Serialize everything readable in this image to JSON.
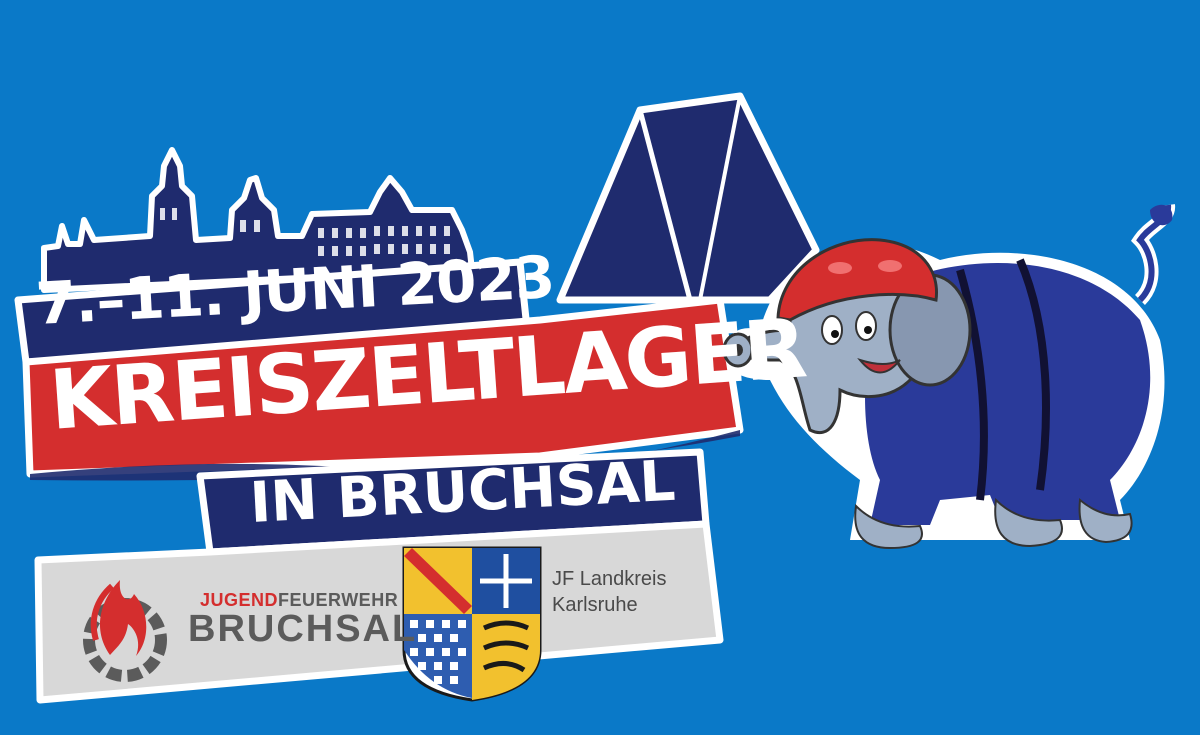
{
  "event": {
    "date": "7.–11. JUNI 2023",
    "title": "KREISZELTLAGER",
    "subtitle": "IN BRUCHSAL"
  },
  "organizers": {
    "jugendfeuerwehr_prefix": "JUGEND",
    "jugendfeuerwehr_suffix": "FEUERWEHR",
    "jugendfeuerwehr_city": "BRUCHSAL",
    "jf_landkreis_line1": "JF Landkreis",
    "jf_landkreis_line2": "Karlsruhe"
  },
  "icons": [
    "castle-skyline",
    "tent-icon",
    "elephant-mascot",
    "flame-gear-logo",
    "coat-of-arms"
  ],
  "colors": {
    "background": "#0a79c8",
    "navy": "#1f2b6e",
    "red": "#d42e2e",
    "grey_panel": "#d8d8d8"
  }
}
